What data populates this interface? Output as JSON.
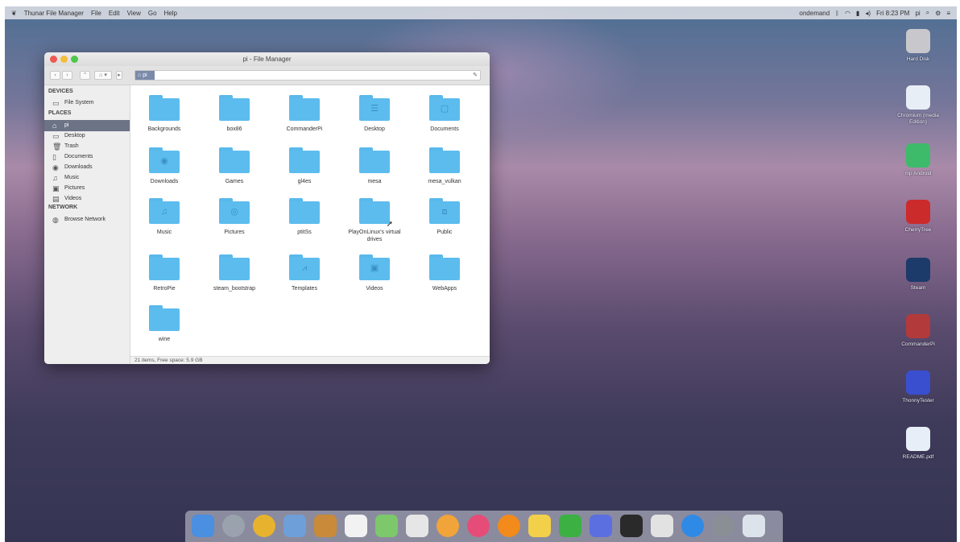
{
  "menubar": {
    "app_name": "Thunar File Manager",
    "menus": [
      "File",
      "Edit",
      "View",
      "Go",
      "Help"
    ],
    "status_text": "ondemand",
    "clock": "Fri 8:23 PM",
    "user": "pi"
  },
  "window": {
    "title": "pi - File Manager",
    "path": "pi"
  },
  "sidebar": {
    "devices_header": "DEVICES",
    "places_header": "PLACES",
    "network_header": "NETWORK",
    "devices": [
      {
        "label": "File System",
        "icon": "drive-icon"
      }
    ],
    "places": [
      {
        "label": "pi",
        "icon": "home-icon",
        "selected": true
      },
      {
        "label": "Desktop",
        "icon": "desktop-icon"
      },
      {
        "label": "Trash",
        "icon": "trash-icon"
      },
      {
        "label": "Documents",
        "icon": "document-icon"
      },
      {
        "label": "Downloads",
        "icon": "download-icon"
      },
      {
        "label": "Music",
        "icon": "music-icon"
      },
      {
        "label": "Pictures",
        "icon": "pictures-icon"
      },
      {
        "label": "Videos",
        "icon": "videos-icon"
      }
    ],
    "network": [
      {
        "label": "Browse Network",
        "icon": "network-icon"
      }
    ]
  },
  "files": [
    {
      "name": "Backgrounds",
      "glyph": ""
    },
    {
      "name": "box86",
      "glyph": ""
    },
    {
      "name": "CommanderPi",
      "glyph": ""
    },
    {
      "name": "Desktop",
      "glyph": "☰"
    },
    {
      "name": "Documents",
      "glyph": "▢"
    },
    {
      "name": "Downloads",
      "glyph": "◉"
    },
    {
      "name": "Games",
      "glyph": ""
    },
    {
      "name": "gl4es",
      "glyph": ""
    },
    {
      "name": "mesa",
      "glyph": ""
    },
    {
      "name": "mesa_vulkan",
      "glyph": ""
    },
    {
      "name": "Music",
      "glyph": "♫"
    },
    {
      "name": "Pictures",
      "glyph": "◎"
    },
    {
      "name": "ptitSs",
      "glyph": ""
    },
    {
      "name": "PlayOnLinux's virtual drives",
      "glyph": "",
      "symlink": true
    },
    {
      "name": "Public",
      "glyph": "⧈"
    },
    {
      "name": "RetroPie",
      "glyph": ""
    },
    {
      "name": "steam_bootstrap",
      "glyph": ""
    },
    {
      "name": "Templates",
      "glyph": "⩘"
    },
    {
      "name": "Videos",
      "glyph": "▣"
    },
    {
      "name": "WebApps",
      "glyph": ""
    },
    {
      "name": "wine",
      "glyph": ""
    }
  ],
  "status": "21 items, Free space: 5.9 GB",
  "desktop_icons": [
    {
      "label": "Hard Disk",
      "icon": "hard-disk-icon",
      "color": "#c8c8cc"
    },
    {
      "label": "Chromium (media Edition)",
      "icon": "chromium-icon",
      "color": "#e8eef6"
    },
    {
      "label": "mp Android",
      "icon": "android-icon",
      "color": "#3dbb6a"
    },
    {
      "label": "CherryTree",
      "icon": "cherry-icon",
      "color": "#cc2b2b"
    },
    {
      "label": "Steam",
      "icon": "steam-icon",
      "color": "#1c3a6a"
    },
    {
      "label": "CommanderPi",
      "icon": "commanderpi-icon",
      "color": "#b33a3a"
    },
    {
      "label": "ThonnyTester",
      "icon": "thonny-icon",
      "color": "#3a4fd0"
    },
    {
      "label": "README.pdf",
      "icon": "pdf-icon",
      "color": "#e8eef8"
    }
  ],
  "dock": [
    {
      "name": "finder-icon",
      "color": "#4a8fe0"
    },
    {
      "name": "launchpad-icon",
      "color": "#9aa3ad"
    },
    {
      "name": "chrome-icon",
      "color": "#e7b32e"
    },
    {
      "name": "preview-icon",
      "color": "#6f9fd8"
    },
    {
      "name": "notes-icon",
      "color": "#c98a3a"
    },
    {
      "name": "calendar-icon",
      "color": "#f2f2f2"
    },
    {
      "name": "maps-icon",
      "color": "#7cc86a"
    },
    {
      "name": "textedit-icon",
      "color": "#e6e6e6"
    },
    {
      "name": "photos-icon",
      "color": "#f0a43a"
    },
    {
      "name": "music-icon",
      "color": "#e54d78"
    },
    {
      "name": "vlc-icon",
      "color": "#f28a1c"
    },
    {
      "name": "notes-yellow-icon",
      "color": "#f3d04a"
    },
    {
      "name": "numbers-icon",
      "color": "#3cb043"
    },
    {
      "name": "keynote-icon",
      "color": "#5b6fe0"
    },
    {
      "name": "terminal-icon",
      "color": "#2a2a2a"
    },
    {
      "name": "books-icon",
      "color": "#e2e2e2"
    },
    {
      "name": "appstore-icon",
      "color": "#2f8ae6"
    },
    {
      "name": "settings-icon",
      "color": "#8a8f96"
    },
    {
      "name": "trash-icon",
      "color": "#dde3ea"
    }
  ]
}
